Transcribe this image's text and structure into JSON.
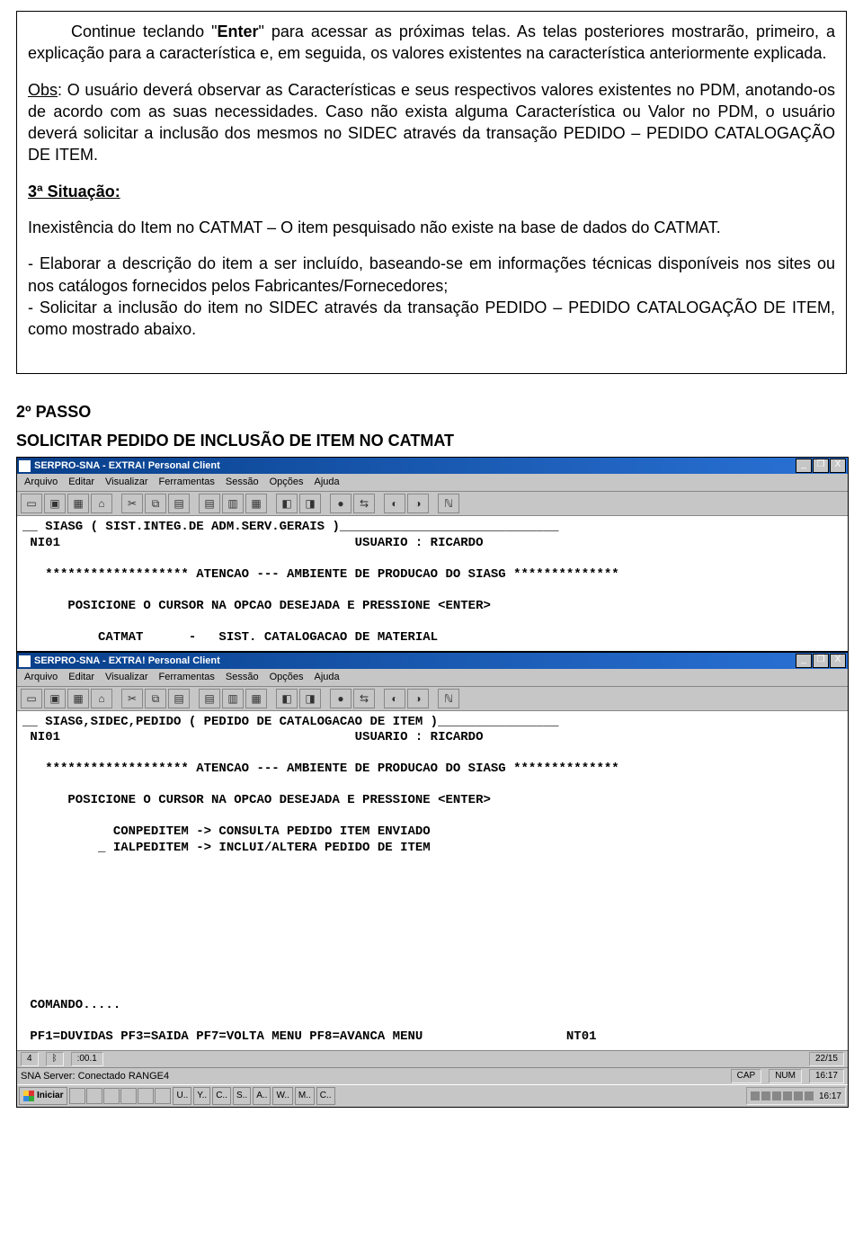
{
  "doc": {
    "p1_a": "Continue teclando \"",
    "p1_kw": "Enter",
    "p1_b": "\" para acessar as próximas telas. As telas posteriores mostrarão, primeiro, a explicação para a característica e, em seguida, os valores existentes na característica anteriormente explicada.",
    "p2_a": "Obs",
    "p2_b": ": O usuário deverá observar as Características e seus respectivos valores existentes no PDM, anotando-os de acordo com as suas necessidades. Caso não exista alguma Característica ou Valor no PDM, o usuário deverá solicitar a inclusão dos mesmos no SIDEC através da transação PEDIDO – PEDIDO CATALOGAÇÃO DE ITEM.",
    "sit_label": "3ª Situação:",
    "p3": "Inexistência do Item no CATMAT – O item pesquisado não existe na base de dados do CATMAT.",
    "p4": "- Elaborar a descrição do item a ser incluído, baseando-se em informações técnicas disponíveis nos sites ou nos catálogos fornecidos pelos Fabricantes/Fornecedores;\n- Solicitar a inclusão do item no SIDEC através da transação PEDIDO – PEDIDO CATALOGAÇÃO DE ITEM, como mostrado abaixo.",
    "passo": "2º PASSO",
    "section_title": "SOLICITAR PEDIDO DE INCLUSÃO DE ITEM NO CATMAT"
  },
  "win": {
    "title": "SERPRO-SNA - EXTRA! Personal Client",
    "btn_min": "_",
    "btn_max": "❐",
    "btn_close": "X",
    "menus": [
      "Arquivo",
      "Editar",
      "Visualizar",
      "Ferramentas",
      "Sessão",
      "Opções",
      "Ajuda"
    ],
    "tool_glyphs": [
      "▭",
      "▣",
      "▦",
      "⌂",
      "",
      "✂",
      "⧉",
      "▤",
      "",
      "▤",
      "▥",
      "▦",
      "",
      "◧",
      "◨",
      "",
      "●",
      "⇆",
      "",
      "◐",
      "◑",
      "",
      "ℕ"
    ]
  },
  "term_top": "__ SIASG ( SIST.INTEG.DE ADM.SERV.GERAIS )_____________________________\n NI01                                       USUARIO : RICARDO\n\n   ******************* ATENCAO --- AMBIENTE DE PRODUCAO DO SIASG **************\n\n      POSICIONE O CURSOR NA OPCAO DESEJADA E PRESSIONE <ENTER>\n\n          CATMAT      -   SIST. CATALOGACAO DE MATERIAL",
  "term_main": "__ SIASG,SIDEC,PEDIDO ( PEDIDO DE CATALOGACAO DE ITEM )________________\n NI01                                       USUARIO : RICARDO\n\n   ******************* ATENCAO --- AMBIENTE DE PRODUCAO DO SIASG **************\n\n      POSICIONE O CURSOR NA OPCAO DESEJADA E PRESSIONE <ENTER>\n\n            CONPEDITEM -> CONSULTA PEDIDO ITEM ENVIADO\n          _ IALPEDITEM -> INCLUI/ALTERA PEDIDO DE ITEM\n\n\n\n\n\n\n\n\n\n COMANDO.....\n\n PF1=DUVIDAS PF3=SAIDA PF7=VOLTA MENU PF8=AVANCA MENU                   NT01",
  "status": {
    "cell1": "4",
    "cell2": "ᛒ",
    "time1": ":00.1",
    "pos": "22/15",
    "sna": "SNA Server: Conectado RANGE4",
    "cap": "CAP",
    "num": "NUM",
    "clock_s": "16:17"
  },
  "taskbar": {
    "start": "Iniciar",
    "tasks": [
      "U..",
      "Y..",
      "C..",
      "S..",
      "A..",
      "W..",
      "M..",
      "C.."
    ],
    "clock": "16:17"
  }
}
